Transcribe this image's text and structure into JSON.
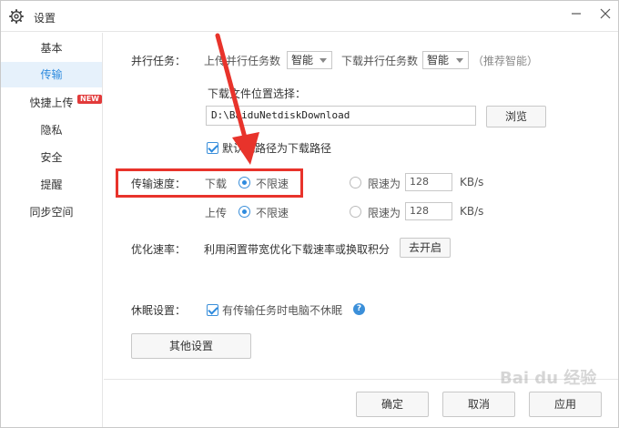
{
  "window": {
    "title": "设置"
  },
  "sidebar": {
    "items": [
      {
        "label": "基本"
      },
      {
        "label": "传输"
      },
      {
        "label": "快捷上传",
        "badge": "NEW"
      },
      {
        "label": "隐私"
      },
      {
        "label": "安全"
      },
      {
        "label": "提醒"
      },
      {
        "label": "同步空间"
      }
    ],
    "active": "传输"
  },
  "parallel": {
    "label": "并行任务：",
    "upload_label": "上传并行任务数",
    "upload_value": "智能",
    "download_label": "下载并行任务数",
    "download_value": "智能",
    "hint": "（推荐智能）"
  },
  "download_path": {
    "label": "下载文件位置选择：",
    "value": "D:\\BaiduNetdiskDownload",
    "browse_label": "浏览",
    "default_checkbox_label": "默认此路径为下载路径",
    "default_checked": true
  },
  "speed": {
    "label": "传输速度：",
    "download_label": "下载",
    "upload_label": "上传",
    "unlimited_label": "不限速",
    "limit_label": "限速为",
    "download_limit_value": "128",
    "upload_limit_value": "128",
    "unit": "KB/s",
    "download_mode": "unlimited",
    "upload_mode": "unlimited"
  },
  "optimize": {
    "label": "优化速率：",
    "description": "利用闲置带宽优化下载速率或换取积分",
    "button_label": "去开启"
  },
  "sleep": {
    "label": "休眠设置：",
    "checkbox_label": "有传输任务时电脑不休眠",
    "checked": true,
    "help": "?"
  },
  "other_settings_label": "其他设置",
  "footer": {
    "ok_label": "确定",
    "cancel_label": "取消",
    "apply_label": "应用"
  },
  "watermark": "Bai du 经验",
  "colors": {
    "accent": "#2e8bde",
    "active_bg": "#e6f1fb",
    "annotation_red": "#e8332b",
    "badge_red": "#e23a3a"
  }
}
